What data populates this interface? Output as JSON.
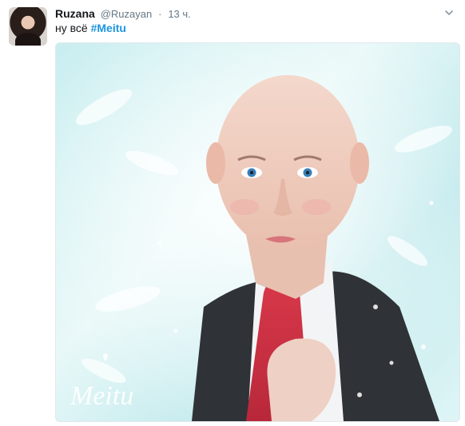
{
  "tweet": {
    "author_name": "Ruzana",
    "author_handle": "@Ruzayan",
    "separator": "·",
    "time": "13 ч.",
    "text_prefix": "ну всё ",
    "hashtag": "#Meitu",
    "watermark": "Meitu"
  },
  "icons": {
    "caret": "chevron-down-icon"
  },
  "colors": {
    "hashtag": "#1b95e0",
    "muted": "#657786",
    "text": "#14171a"
  }
}
